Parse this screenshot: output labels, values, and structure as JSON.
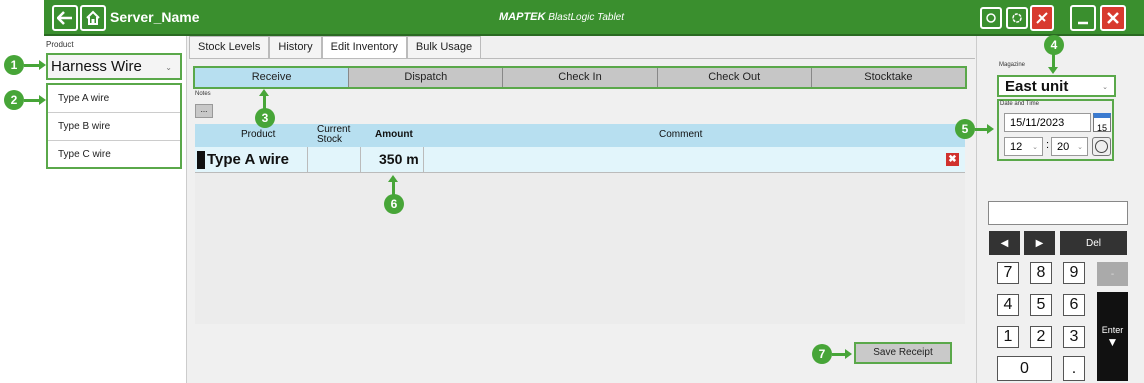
{
  "titlebar": {
    "server_name": "Server_Name",
    "logo_brand": "MAPTEK",
    "logo_product": "BlastLogic Tablet",
    "back_icon": "arrow-left-icon",
    "home_icon": "home-icon",
    "refresh_icon": "refresh-icon",
    "sync_icon": "sync-icon",
    "disconnect_icon": "disconnect-icon",
    "minimize_icon": "minimize-icon",
    "close_icon": "close-icon",
    "accent_color": "#3a8f2e"
  },
  "product_panel": {
    "label": "Product",
    "selected": "Harness Wire",
    "items": [
      {
        "label": "Type A wire"
      },
      {
        "label": "Type B wire"
      },
      {
        "label": "Type C wire"
      }
    ]
  },
  "tabs": [
    {
      "label": "Stock Levels"
    },
    {
      "label": "History"
    },
    {
      "label": "Edit Inventory",
      "active": true
    },
    {
      "label": "Bulk Usage"
    }
  ],
  "actions": [
    {
      "label": "Receive",
      "active": true
    },
    {
      "label": "Dispatch"
    },
    {
      "label": "Check In"
    },
    {
      "label": "Check Out"
    },
    {
      "label": "Stocktake"
    }
  ],
  "notes": {
    "label": "Notes",
    "button": "..."
  },
  "table": {
    "headers": {
      "product": "Product",
      "current_stock": "Current Stock",
      "amount": "Amount",
      "comment": "Comment"
    },
    "rows": [
      {
        "product": "Type A wire",
        "current_stock": "",
        "amount": "350",
        "unit": "m",
        "comment": ""
      }
    ]
  },
  "save_button": "Save Receipt",
  "magazine": {
    "label": "Magazine",
    "selected": "East unit"
  },
  "datetime": {
    "label": "Date and Time",
    "date": "15/11/2023",
    "calendar_day": "15",
    "hour": "12",
    "minute": "20",
    "separator": ":"
  },
  "keypad": {
    "del": "Del",
    "keys": [
      "7",
      "8",
      "9",
      "4",
      "5",
      "6",
      "1",
      "2",
      "3",
      "0",
      "."
    ],
    "minus": "-",
    "enter": "Enter"
  },
  "callouts": [
    "1",
    "2",
    "3",
    "4",
    "5",
    "6",
    "7"
  ]
}
